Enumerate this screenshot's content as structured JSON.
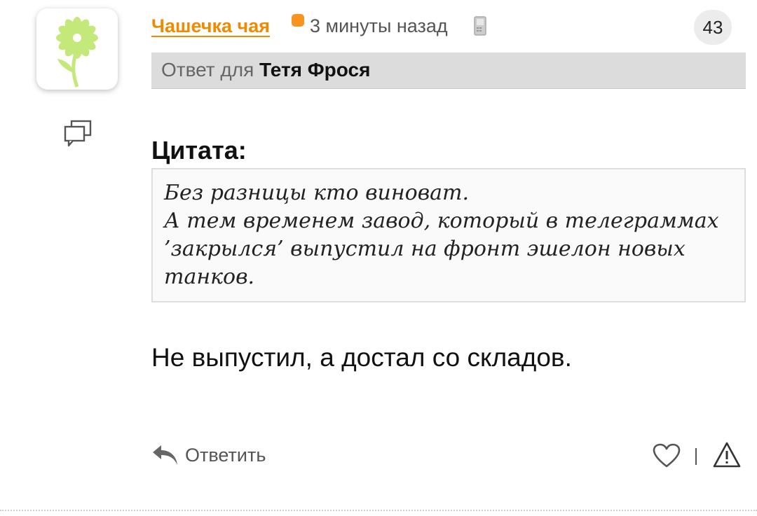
{
  "comment": {
    "author": "Чашечка чая",
    "time": "3 минуты назад",
    "count": "43",
    "reply_to_prefix": "Ответ для",
    "reply_to_name": "Тетя Фрося",
    "quote_title": "Цитата:",
    "quote_text": "Без разницы кто виноват.\nА тем временем завод, который в телеграммах ’закрылся’ выпустил на фронт эшелон новых танков.",
    "body": "Не выпустил, а достал со складов.",
    "reply_label": "Ответить"
  },
  "colors": {
    "accent": "#f08a00",
    "status": "#f7931e",
    "flower": "#c4e87a",
    "reply_bg": "#dcdcdc"
  },
  "icons": {
    "avatar": "flower-icon",
    "thread": "speech-bubbles-icon",
    "device": "mobile-phone-icon",
    "reply": "reply-arrow-icon",
    "like": "heart-icon",
    "report": "warning-triangle-icon"
  }
}
